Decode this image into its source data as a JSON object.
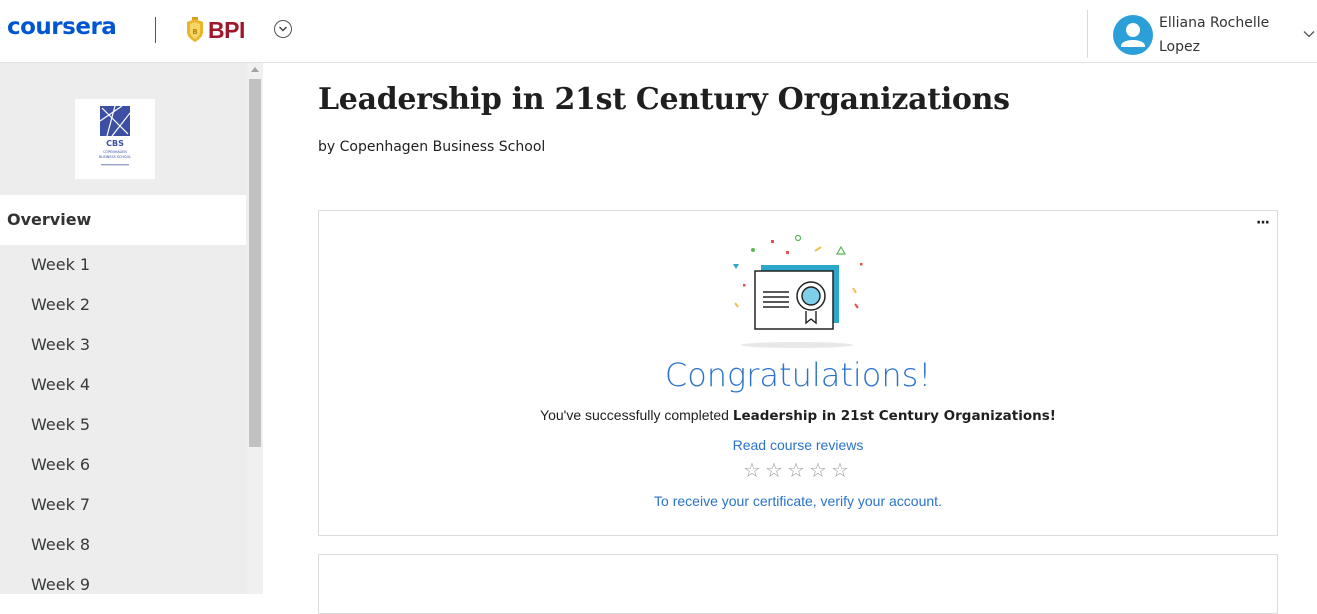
{
  "header": {
    "brand": "coursera",
    "partner": "BPI",
    "user_name": "Elliana Rochelle Lopez",
    "icons": [
      "org-dropdown-icon",
      "user-avatar-icon",
      "chevron-down-icon"
    ]
  },
  "sidebar": {
    "logo_text": "CBS",
    "logo_subtext": "COPENHAGEN BUSINESS SCHOOL",
    "overview_label": "Overview",
    "weeks": [
      "Week 1",
      "Week 2",
      "Week 3",
      "Week 4",
      "Week 5",
      "Week 6",
      "Week 7",
      "Week 8",
      "Week 9"
    ]
  },
  "main": {
    "title": "Leadership in 21st Century Organizations",
    "by_line": "by Copenhagen Business School",
    "card": {
      "more_label": "···",
      "congrats": "Congratulations!",
      "completed_prefix": "You've successfully completed ",
      "completed_course": "Leadership in 21st Century Organizations",
      "completed_suffix": "!",
      "reviews_link": "Read course reviews",
      "rating": 0,
      "rating_max": 5,
      "verify_link": "To receive your certificate, verify your account."
    }
  },
  "colors": {
    "brand_blue": "#0056d2",
    "bpi_red": "#a0172b",
    "link_blue": "#2a73cc",
    "sidebar_bg": "#ededed"
  }
}
